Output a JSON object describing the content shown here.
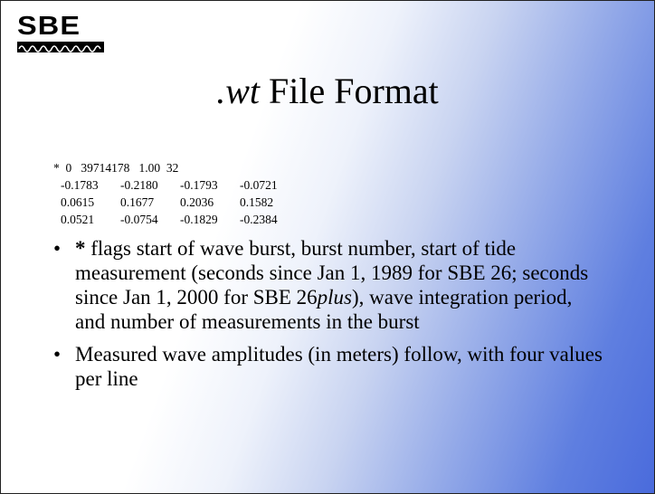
{
  "logo": {
    "text": "SBE"
  },
  "title": {
    "ext": ".wt",
    "rest": " File Format"
  },
  "data_block": {
    "header": "*  0   39714178   1.00  32",
    "rows": [
      [
        "-0.1783",
        "-0.2180",
        "-0.1793",
        "-0.0721"
      ],
      [
        "0.0615",
        "0.1677",
        "0.2036",
        "0.1582"
      ],
      [
        "0.0521",
        "-0.0754",
        "-0.1829",
        "-0.2384"
      ]
    ]
  },
  "bullets": [
    {
      "marker": "•",
      "star": "*",
      "text_1": " flags start of wave burst, burst number, start of tide measurement (seconds since Jan 1, 1989 for SBE 26; seconds since Jan 1, 2000 for SBE 26",
      "plus": "plus",
      "text_2": "), wave integration period, and number of measurements in the burst"
    },
    {
      "marker": "•",
      "text": "Measured wave amplitudes (in meters) follow, with four values per line"
    }
  ]
}
